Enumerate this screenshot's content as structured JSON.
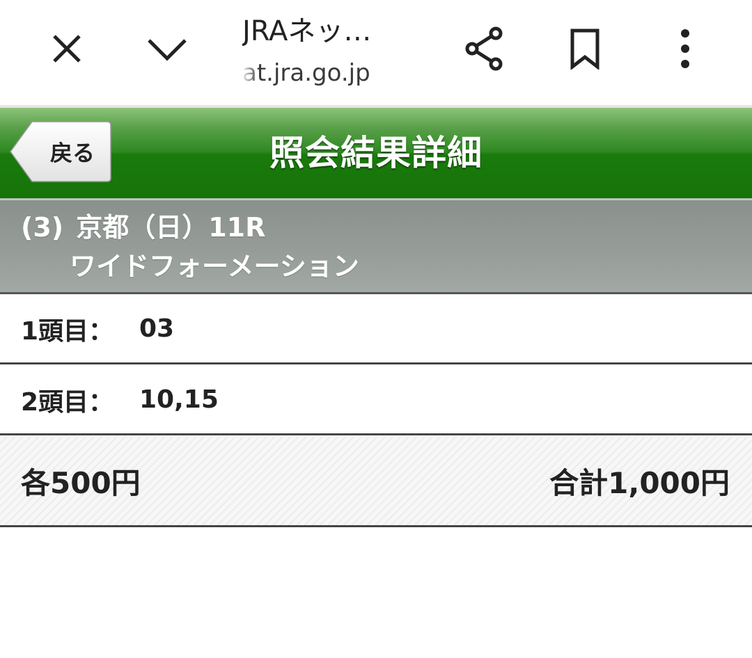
{
  "browser": {
    "title": "JRAネッ…",
    "url": "at.jra.go.jp",
    "icons": [
      "close-icon",
      "chevron-down-icon",
      "share-icon",
      "bookmark-icon",
      "more-vertical-icon"
    ]
  },
  "header": {
    "back_label": "戻る",
    "title": "照会結果詳細",
    "accent_color": "#1a7a0c"
  },
  "race": {
    "number": "(3)",
    "venue_day": "京都（日）11R",
    "bet_type": "ワイドフォーメーション"
  },
  "selections": [
    {
      "label": "1頭目：",
      "value": "03"
    },
    {
      "label": "2頭目：",
      "value": "10,15"
    }
  ],
  "totals": {
    "unit": "各500円",
    "total": "合計1,000円"
  }
}
